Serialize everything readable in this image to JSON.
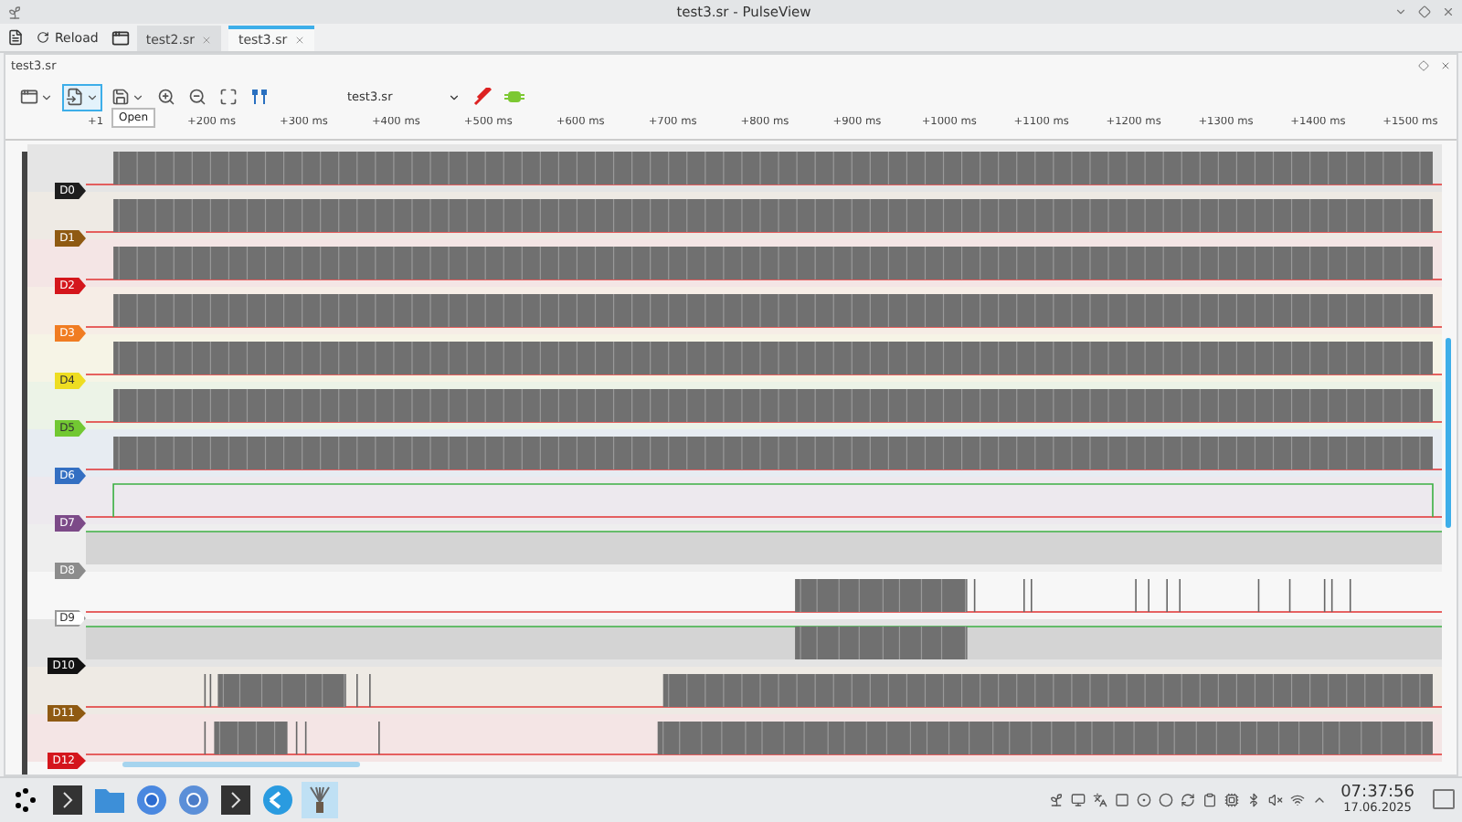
{
  "window": {
    "title": "test3.sr - PulseView"
  },
  "session_bar": {
    "reload": "Reload"
  },
  "tabs": [
    {
      "label": "test2.sr",
      "selected": false
    },
    {
      "label": "test3.sr",
      "selected": true
    }
  ],
  "document": {
    "title": "test3.sr"
  },
  "toolbar": {
    "device": "test3.sr",
    "tooltip": "Open"
  },
  "ruler": {
    "ticks": [
      "+1",
      "+200 ms",
      "+300 ms",
      "+400 ms",
      "+500 ms",
      "+600 ms",
      "+700 ms",
      "+800 ms",
      "+900 ms",
      "+1000 ms",
      "+1100 ms",
      "+1200 ms",
      "+1300 ms",
      "+1400 ms",
      "+1500 ms"
    ]
  },
  "channels": [
    {
      "name": "D0",
      "color": "#1e1e1e"
    },
    {
      "name": "D1",
      "color": "#8f5a12"
    },
    {
      "name": "D2",
      "color": "#d4161c"
    },
    {
      "name": "D3",
      "color": "#f07c22"
    },
    {
      "name": "D4",
      "color": "#eedd22"
    },
    {
      "name": "D5",
      "color": "#72c832"
    },
    {
      "name": "D6",
      "color": "#336fc2"
    },
    {
      "name": "D7",
      "color": "#7c4a88"
    },
    {
      "name": "D8",
      "color": "#8c8c8c"
    },
    {
      "name": "D9",
      "color": "#ffffff"
    },
    {
      "name": "D10",
      "color": "#121212"
    },
    {
      "name": "D11",
      "color": "#8f5a12"
    },
    {
      "name": "D12",
      "color": "#d4161c"
    }
  ],
  "taskbar": {
    "time": "07:37:56",
    "date": "17.06.2025"
  }
}
